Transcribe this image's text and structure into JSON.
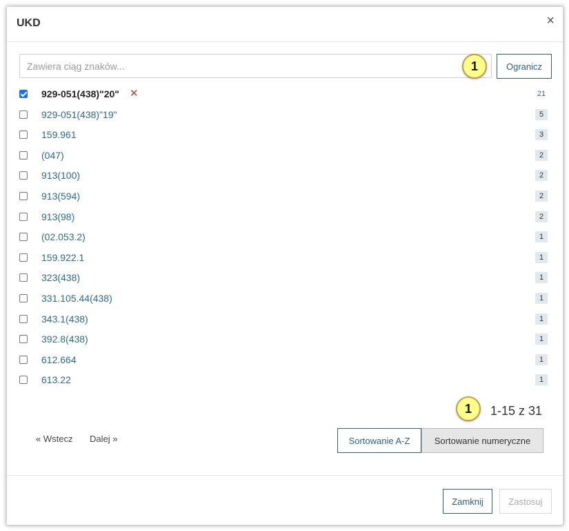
{
  "dialog": {
    "title": "UKD",
    "close_symbol": "×"
  },
  "search": {
    "placeholder": "Zawiera ciąg znaków...",
    "value": "",
    "badge": "1",
    "submit_label": "Ogranicz"
  },
  "remove_symbol": "✕",
  "items": [
    {
      "label": "929-051(438)\"20\"",
      "count": "21",
      "checked": true
    },
    {
      "label": "929-051(438)\"19\"",
      "count": "5",
      "checked": false
    },
    {
      "label": "159.961",
      "count": "3",
      "checked": false
    },
    {
      "label": "(047)",
      "count": "2",
      "checked": false
    },
    {
      "label": "913(100)",
      "count": "2",
      "checked": false
    },
    {
      "label": "913(594)",
      "count": "2",
      "checked": false
    },
    {
      "label": "913(98)",
      "count": "2",
      "checked": false
    },
    {
      "label": "(02.053.2)",
      "count": "1",
      "checked": false
    },
    {
      "label": "159.922.1",
      "count": "1",
      "checked": false
    },
    {
      "label": "323(438)",
      "count": "1",
      "checked": false
    },
    {
      "label": "331.105.44(438)",
      "count": "1",
      "checked": false
    },
    {
      "label": "343.1(438)",
      "count": "1",
      "checked": false
    },
    {
      "label": "392.8(438)",
      "count": "1",
      "checked": false
    },
    {
      "label": "612.664",
      "count": "1",
      "checked": false
    },
    {
      "label": "613.22",
      "count": "1",
      "checked": false
    }
  ],
  "pagination": {
    "badge": "1",
    "range_text": "1-15 z 31",
    "prev_label": "« Wstecz",
    "next_label": "Dalej »"
  },
  "sort": {
    "alpha_label": "Sortowanie A-Z",
    "numeric_label": "Sortowanie numeryczne"
  },
  "footer": {
    "close_label": "Zamknij",
    "apply_label": "Zastosuj"
  },
  "colors": {
    "link": "#2b6a91",
    "accent_border": "#2f5d7e",
    "badge_fill": "#ffff8c",
    "remove": "#c0392b"
  }
}
